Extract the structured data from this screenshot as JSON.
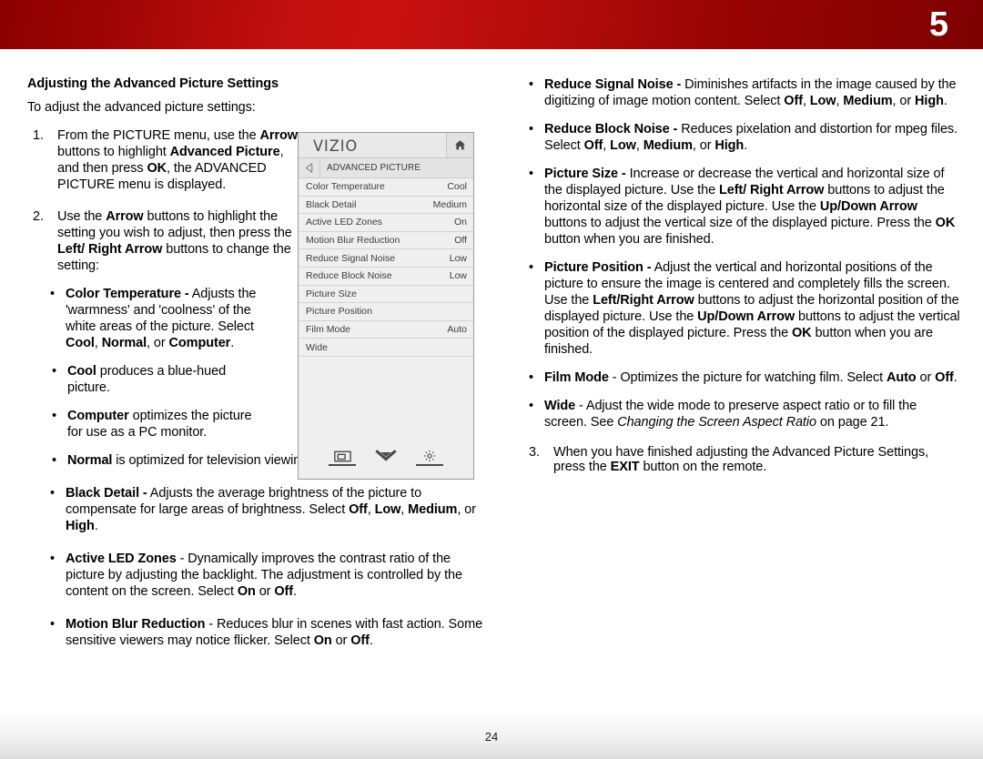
{
  "header": {
    "chapter_number": "5",
    "accent_color": "#c41010"
  },
  "left_column": {
    "section_title": "Adjusting the Advanced Picture Settings",
    "lead": "To adjust the advanced picture settings:",
    "steps": [
      {
        "num": "1.",
        "html": "From the PICTURE menu, use the <b>Arrow</b> buttons to highlight <b>Advanced Picture</b>, and then press <b>OK</b>, the ADVANCED PICTURE menu is displayed."
      },
      {
        "num": "2.",
        "html": "Use the <b>Arrow</b> buttons to highlight the setting you wish to adjust, then press the <b>Left/ Right Arrow</b> buttons to change the setting:"
      }
    ],
    "sub_bullets": [
      {
        "html": "<b>Color Temperature -</b> Adjusts the 'warmness' and 'coolness' of the white areas of the picture. Select <b>Cool</b>, <b>Normal</b>, or <b>Computer</b>."
      }
    ],
    "sub_sub_bullets": [
      {
        "html": "<b>Cool</b> produces a blue-hued picture."
      },
      {
        "html": "<b>Computer</b> optimizes the picture for use as a PC monitor."
      },
      {
        "html": "<b>Normal</b> is optimized for television viewing."
      }
    ],
    "outer_bullets": [
      {
        "html": "<b>Black Detail -</b> Adjusts the average brightness of the picture to compensate for large areas of brightness. Select <b>Off</b>, <b>Low</b>, <b>Medium</b>, or <b>High</b>."
      },
      {
        "html": "<b>Active LED Zones</b> - Dynamically improves the contrast ratio of the picture by adjusting the backlight. The adjustment is controlled by the content on the screen. Select <b>On</b> or <b>Off</b>."
      },
      {
        "html": "<b>Motion Blur Reduction</b> - Reduces blur in scenes with fast action. Some sensitive viewers may notice flicker. Select <b>On</b> or <b>Off</b>."
      }
    ]
  },
  "right_column": {
    "bullets": [
      {
        "html": "<b>Reduce Signal Noise -</b> Diminishes artifacts in the image caused by the digitizing of image motion content. Select <b>Off</b>, <b>Low</b>, <b>Medium</b>, or <b>High</b>."
      },
      {
        "html": "<b>Reduce Block Noise -</b> Reduces pixelation and distortion for mpeg files. Select <b>Off</b>, <b>Low</b>, <b>Medium</b>, or <b>High</b>."
      },
      {
        "html": "<b>Picture Size -</b> Increase or decrease the vertical and horizontal size of the displayed picture. Use the <b>Left/ Right Arrow</b> buttons to adjust the horizontal size of the displayed picture. Use the <b>Up/Down Arrow</b> buttons to adjust the vertical size of the displayed picture. Press the <b>OK</b> button when you are finished."
      },
      {
        "html": "<b>Picture Position -</b> Adjust the vertical and horizontal positions of the picture to ensure the image is centered and completely fills the screen. Use the <b>Left/Right Arrow</b> buttons to adjust the horizontal position of the displayed picture. Use the <b>Up/Down Arrow</b> buttons to adjust the vertical position of the displayed picture. Press the <b>OK</b> button when you are finished."
      },
      {
        "html": "<b>Film Mode</b> - Optimizes the picture for watching film. Select <b>Auto</b> or <b>Off</b>."
      },
      {
        "html": "<b>Wide</b> - Adjust the wide mode to preserve aspect ratio or to fill the screen. See <i>Changing the Screen Aspect Ratio</i> on page 21."
      }
    ],
    "final_step": {
      "num": "3.",
      "html": "When you have finished adjusting the Advanced Picture Settings, press the <b>EXIT</b> button on the remote."
    }
  },
  "tv_menu": {
    "brand": "VIZIO",
    "home_icon": "home-icon",
    "back_icon": "back-arrow-icon",
    "breadcrumb": "ADVANCED PICTURE",
    "rows": [
      {
        "label": "Color Temperature",
        "value": "Cool"
      },
      {
        "label": "Black Detail",
        "value": "Medium"
      },
      {
        "label": "Active LED Zones",
        "value": "On"
      },
      {
        "label": "Motion Blur Reduction",
        "value": "Off"
      },
      {
        "label": "Reduce Signal Noise",
        "value": "Low"
      },
      {
        "label": "Reduce Block Noise",
        "value": "Low"
      },
      {
        "label": "Picture Size",
        "value": ""
      },
      {
        "label": "Picture Position",
        "value": ""
      },
      {
        "label": "Film Mode",
        "value": "Auto"
      },
      {
        "label": "Wide",
        "value": ""
      }
    ],
    "footer_icons": [
      "screen-icon",
      "chevron-down-icon",
      "gear-icon"
    ]
  },
  "footer": {
    "page_number": "24"
  }
}
